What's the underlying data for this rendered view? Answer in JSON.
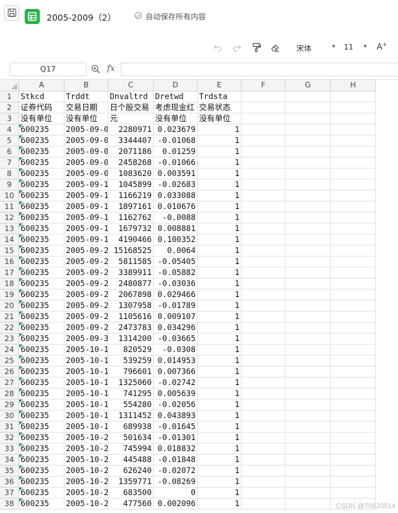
{
  "titlebar": {
    "doc_title": "2005-2009（2）",
    "autosave_text": "自动保存所有内容"
  },
  "toolbar": {
    "font_name": "宋体",
    "font_size": "11",
    "grow_label": "A"
  },
  "formula_bar": {
    "cell_ref": "Q17",
    "fx_label": "fx",
    "formula": ""
  },
  "grid": {
    "columns": [
      "A",
      "B",
      "C",
      "D",
      "E",
      "F",
      "G",
      "H"
    ],
    "row_numbers": [
      "1",
      "2",
      "3",
      "4",
      "5",
      "6",
      "7",
      "8",
      "9",
      "10",
      "11",
      "12",
      "13",
      "14",
      "15",
      "16",
      "17",
      "18",
      "19",
      "20",
      "21",
      "22",
      "23",
      "24",
      "25",
      "26",
      "27",
      "28",
      "29",
      "30",
      "31",
      "32",
      "33",
      "34",
      "35",
      "36",
      "37",
      "38"
    ],
    "header_rows": [
      [
        "Stkcd",
        "Trddt",
        "Dnvaltrd",
        "Dretwd",
        "Trdsta"
      ],
      [
        "证券代码",
        "交易日期",
        "日个股交易",
        "考虑现金红",
        "交易状态"
      ],
      [
        "没有单位",
        "没有单位",
        "元",
        "没有单位",
        "没有单位"
      ]
    ],
    "data_rows": [
      [
        "600235",
        "2005-09-0",
        "2280971",
        "0.023679",
        "1"
      ],
      [
        "600235",
        "2005-09-0",
        "3344407",
        "-0.01068",
        "1"
      ],
      [
        "600235",
        "2005-09-0",
        "2071186",
        "0.01259",
        "1"
      ],
      [
        "600235",
        "2005-09-0",
        "2458268",
        "-0.01066",
        "1"
      ],
      [
        "600235",
        "2005-09-0",
        "1083620",
        "0.003591",
        "1"
      ],
      [
        "600235",
        "2005-09-1",
        "1045899",
        "-0.02683",
        "1"
      ],
      [
        "600235",
        "2005-09-1",
        "1166219",
        "0.033088",
        "1"
      ],
      [
        "600235",
        "2005-09-1",
        "1897161",
        "0.010676",
        "1"
      ],
      [
        "600235",
        "2005-09-1",
        "1162762",
        "-0.0088",
        "1"
      ],
      [
        "600235",
        "2005-09-1",
        "1679732",
        "0.008881",
        "1"
      ],
      [
        "600235",
        "2005-09-1",
        "4190466",
        "0.100352",
        "1"
      ],
      [
        "600235",
        "2005-09-2",
        "15168525",
        "0.0064",
        "1"
      ],
      [
        "600235",
        "2005-09-2",
        "5811585",
        "-0.05405",
        "1"
      ],
      [
        "600235",
        "2005-09-2",
        "3389911",
        "-0.05882",
        "1"
      ],
      [
        "600235",
        "2005-09-2",
        "2480877",
        "-0.03036",
        "1"
      ],
      [
        "600235",
        "2005-09-2",
        "2067898",
        "0.029466",
        "1"
      ],
      [
        "600235",
        "2005-09-2",
        "1307958",
        "-0.01789",
        "1"
      ],
      [
        "600235",
        "2005-09-2",
        "1105616",
        "0.009107",
        "1"
      ],
      [
        "600235",
        "2005-09-2",
        "2473783",
        "0.034296",
        "1"
      ],
      [
        "600235",
        "2005-09-3",
        "1314200",
        "-0.03665",
        "1"
      ],
      [
        "600235",
        "2005-10-1",
        "820529",
        "-0.0308",
        "1"
      ],
      [
        "600235",
        "2005-10-1",
        "539259",
        "0.014953",
        "1"
      ],
      [
        "600235",
        "2005-10-1",
        "796601",
        "0.007366",
        "1"
      ],
      [
        "600235",
        "2005-10-1",
        "1325060",
        "-0.02742",
        "1"
      ],
      [
        "600235",
        "2005-10-1",
        "741295",
        "0.005639",
        "1"
      ],
      [
        "600235",
        "2005-10-1",
        "554280",
        "-0.02056",
        "1"
      ],
      [
        "600235",
        "2005-10-1",
        "1311452",
        "0.043893",
        "1"
      ],
      [
        "600235",
        "2005-10-1",
        "689938",
        "-0.01645",
        "1"
      ],
      [
        "600235",
        "2005-10-2",
        "501634",
        "-0.01301",
        "1"
      ],
      [
        "600235",
        "2005-10-2",
        "745994",
        "0.018832",
        "1"
      ],
      [
        "600235",
        "2005-10-2",
        "445488",
        "-0.01848",
        "1"
      ],
      [
        "600235",
        "2005-10-2",
        "626240",
        "-0.02072",
        "1"
      ],
      [
        "600235",
        "2005-10-2",
        "1359771",
        "-0.08269",
        "1"
      ],
      [
        "600235",
        "2005-10-2",
        "683500",
        "0",
        "1"
      ],
      [
        "600235",
        "2005-10-2",
        "477560",
        "0.002096",
        "1"
      ]
    ]
  },
  "watermark": "CSDN @T0620514",
  "colors": {
    "app_green": "#2bb24c",
    "number_stored_as_text_marker": "#1b9e4b",
    "header_bg": "#f4f4f4",
    "gridline": "#e2e2e2"
  },
  "icons": [
    "save-icon",
    "spreadsheet-app-icon",
    "cloud-check-icon",
    "undo-icon",
    "redo-icon",
    "format-painter-icon",
    "eraser-icon",
    "dropdown-caret-icon",
    "zoom-icon",
    "fx-icon"
  ]
}
